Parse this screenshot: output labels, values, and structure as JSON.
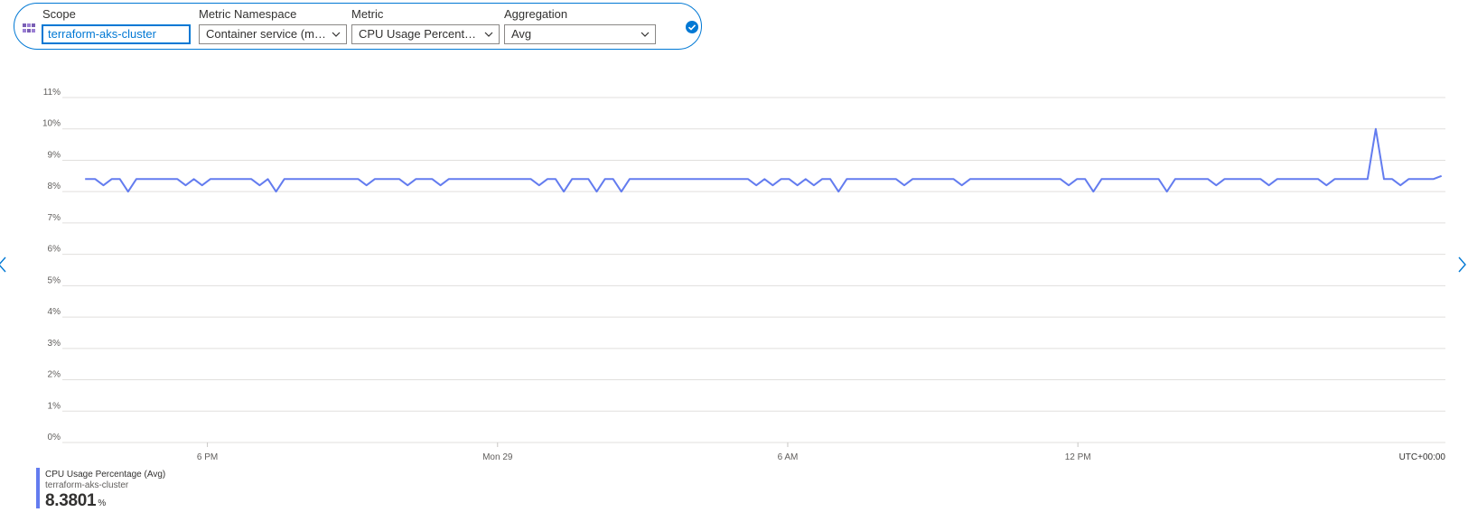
{
  "query": {
    "scope_label": "Scope",
    "scope_value": "terraform-aks-cluster",
    "namespace_label": "Metric Namespace",
    "namespace_value": "Container service (m…",
    "metric_label": "Metric",
    "metric_value": "CPU Usage Percent…",
    "aggregation_label": "Aggregation",
    "aggregation_value": "Avg",
    "icons": {
      "scope": "aks-cluster-icon",
      "confirm": "checkmark-circle-icon",
      "dropdown": "chevron-down-icon"
    }
  },
  "colors": {
    "accent": "#0078d4",
    "series": "#637cef",
    "grid": "#e1dfdd"
  },
  "nav": {
    "prev_icon": "chevron-left-icon",
    "next_icon": "chevron-right-icon"
  },
  "chart_data": {
    "type": "line",
    "y_ticks": [
      "0%",
      "1%",
      "2%",
      "3%",
      "4%",
      "5%",
      "6%",
      "7%",
      "8%",
      "9%",
      "10%",
      "11%"
    ],
    "ylim": [
      0,
      11
    ],
    "x_ticks": [
      {
        "label": "6 PM",
        "x": 3.0
      },
      {
        "label": "Mon 29",
        "x": 9.0
      },
      {
        "label": "6 AM",
        "x": 15.0
      },
      {
        "label": "12 PM",
        "x": 21.0
      }
    ],
    "xlim": [
      0,
      24
    ],
    "timezone_label": "UTC+00:00",
    "grid": true,
    "series": [
      {
        "name": "CPU Usage Percentage (Avg)",
        "baseline": 8.4,
        "x_start": 0.47,
        "x_end": 24.39,
        "points": [
          [
            0.47,
            8.4
          ],
          [
            0.68,
            8.4
          ],
          [
            0.85,
            8.2
          ],
          [
            1.02,
            8.4
          ],
          [
            1.19,
            8.4
          ],
          [
            1.36,
            8.0
          ],
          [
            1.53,
            8.4
          ],
          [
            2.38,
            8.4
          ],
          [
            2.55,
            8.2
          ],
          [
            2.72,
            8.4
          ],
          [
            2.89,
            8.2
          ],
          [
            3.06,
            8.4
          ],
          [
            3.91,
            8.4
          ],
          [
            4.08,
            8.2
          ],
          [
            4.25,
            8.4
          ],
          [
            4.42,
            8.0
          ],
          [
            4.59,
            8.4
          ],
          [
            6.12,
            8.4
          ],
          [
            6.29,
            8.2
          ],
          [
            6.46,
            8.4
          ],
          [
            6.97,
            8.4
          ],
          [
            7.14,
            8.2
          ],
          [
            7.31,
            8.4
          ],
          [
            7.65,
            8.4
          ],
          [
            7.82,
            8.2
          ],
          [
            7.99,
            8.4
          ],
          [
            9.69,
            8.4
          ],
          [
            9.86,
            8.2
          ],
          [
            10.03,
            8.4
          ],
          [
            10.2,
            8.4
          ],
          [
            10.37,
            8.0
          ],
          [
            10.54,
            8.4
          ],
          [
            10.88,
            8.4
          ],
          [
            11.05,
            8.0
          ],
          [
            11.22,
            8.4
          ],
          [
            11.39,
            8.4
          ],
          [
            11.56,
            8.0
          ],
          [
            11.73,
            8.4
          ],
          [
            14.18,
            8.4
          ],
          [
            14.35,
            8.2
          ],
          [
            14.52,
            8.4
          ],
          [
            14.69,
            8.2
          ],
          [
            14.86,
            8.4
          ],
          [
            15.03,
            8.4
          ],
          [
            15.2,
            8.2
          ],
          [
            15.37,
            8.4
          ],
          [
            15.54,
            8.2
          ],
          [
            15.71,
            8.4
          ],
          [
            15.88,
            8.4
          ],
          [
            16.05,
            8.0
          ],
          [
            16.22,
            8.4
          ],
          [
            17.24,
            8.4
          ],
          [
            17.41,
            8.2
          ],
          [
            17.58,
            8.4
          ],
          [
            18.43,
            8.4
          ],
          [
            18.6,
            8.2
          ],
          [
            18.77,
            8.4
          ],
          [
            20.64,
            8.4
          ],
          [
            20.81,
            8.2
          ],
          [
            20.98,
            8.4
          ],
          [
            21.15,
            8.4
          ],
          [
            21.32,
            8.0
          ],
          [
            21.49,
            8.4
          ],
          [
            22.67,
            8.4
          ],
          [
            22.84,
            8.0
          ],
          [
            23.01,
            8.4
          ],
          [
            23.69,
            8.4
          ],
          [
            23.86,
            8.2
          ],
          [
            24.03,
            8.4
          ],
          [
            24.78,
            8.4
          ],
          [
            24.95,
            8.2
          ],
          [
            25.12,
            8.4
          ],
          [
            25.97,
            8.4
          ],
          [
            26.14,
            8.2
          ],
          [
            26.31,
            8.4
          ],
          [
            26.99,
            8.4
          ],
          [
            27.16,
            10.0
          ],
          [
            27.33,
            8.4
          ],
          [
            27.5,
            8.4
          ],
          [
            27.67,
            8.2
          ],
          [
            27.84,
            8.4
          ],
          [
            28.35,
            8.4
          ],
          [
            28.52,
            8.5
          ]
        ]
      }
    ]
  },
  "legend": {
    "name": "CPU Usage Percentage (Avg)",
    "resource": "terraform-aks-cluster",
    "value": "8.3801",
    "unit": "%"
  }
}
